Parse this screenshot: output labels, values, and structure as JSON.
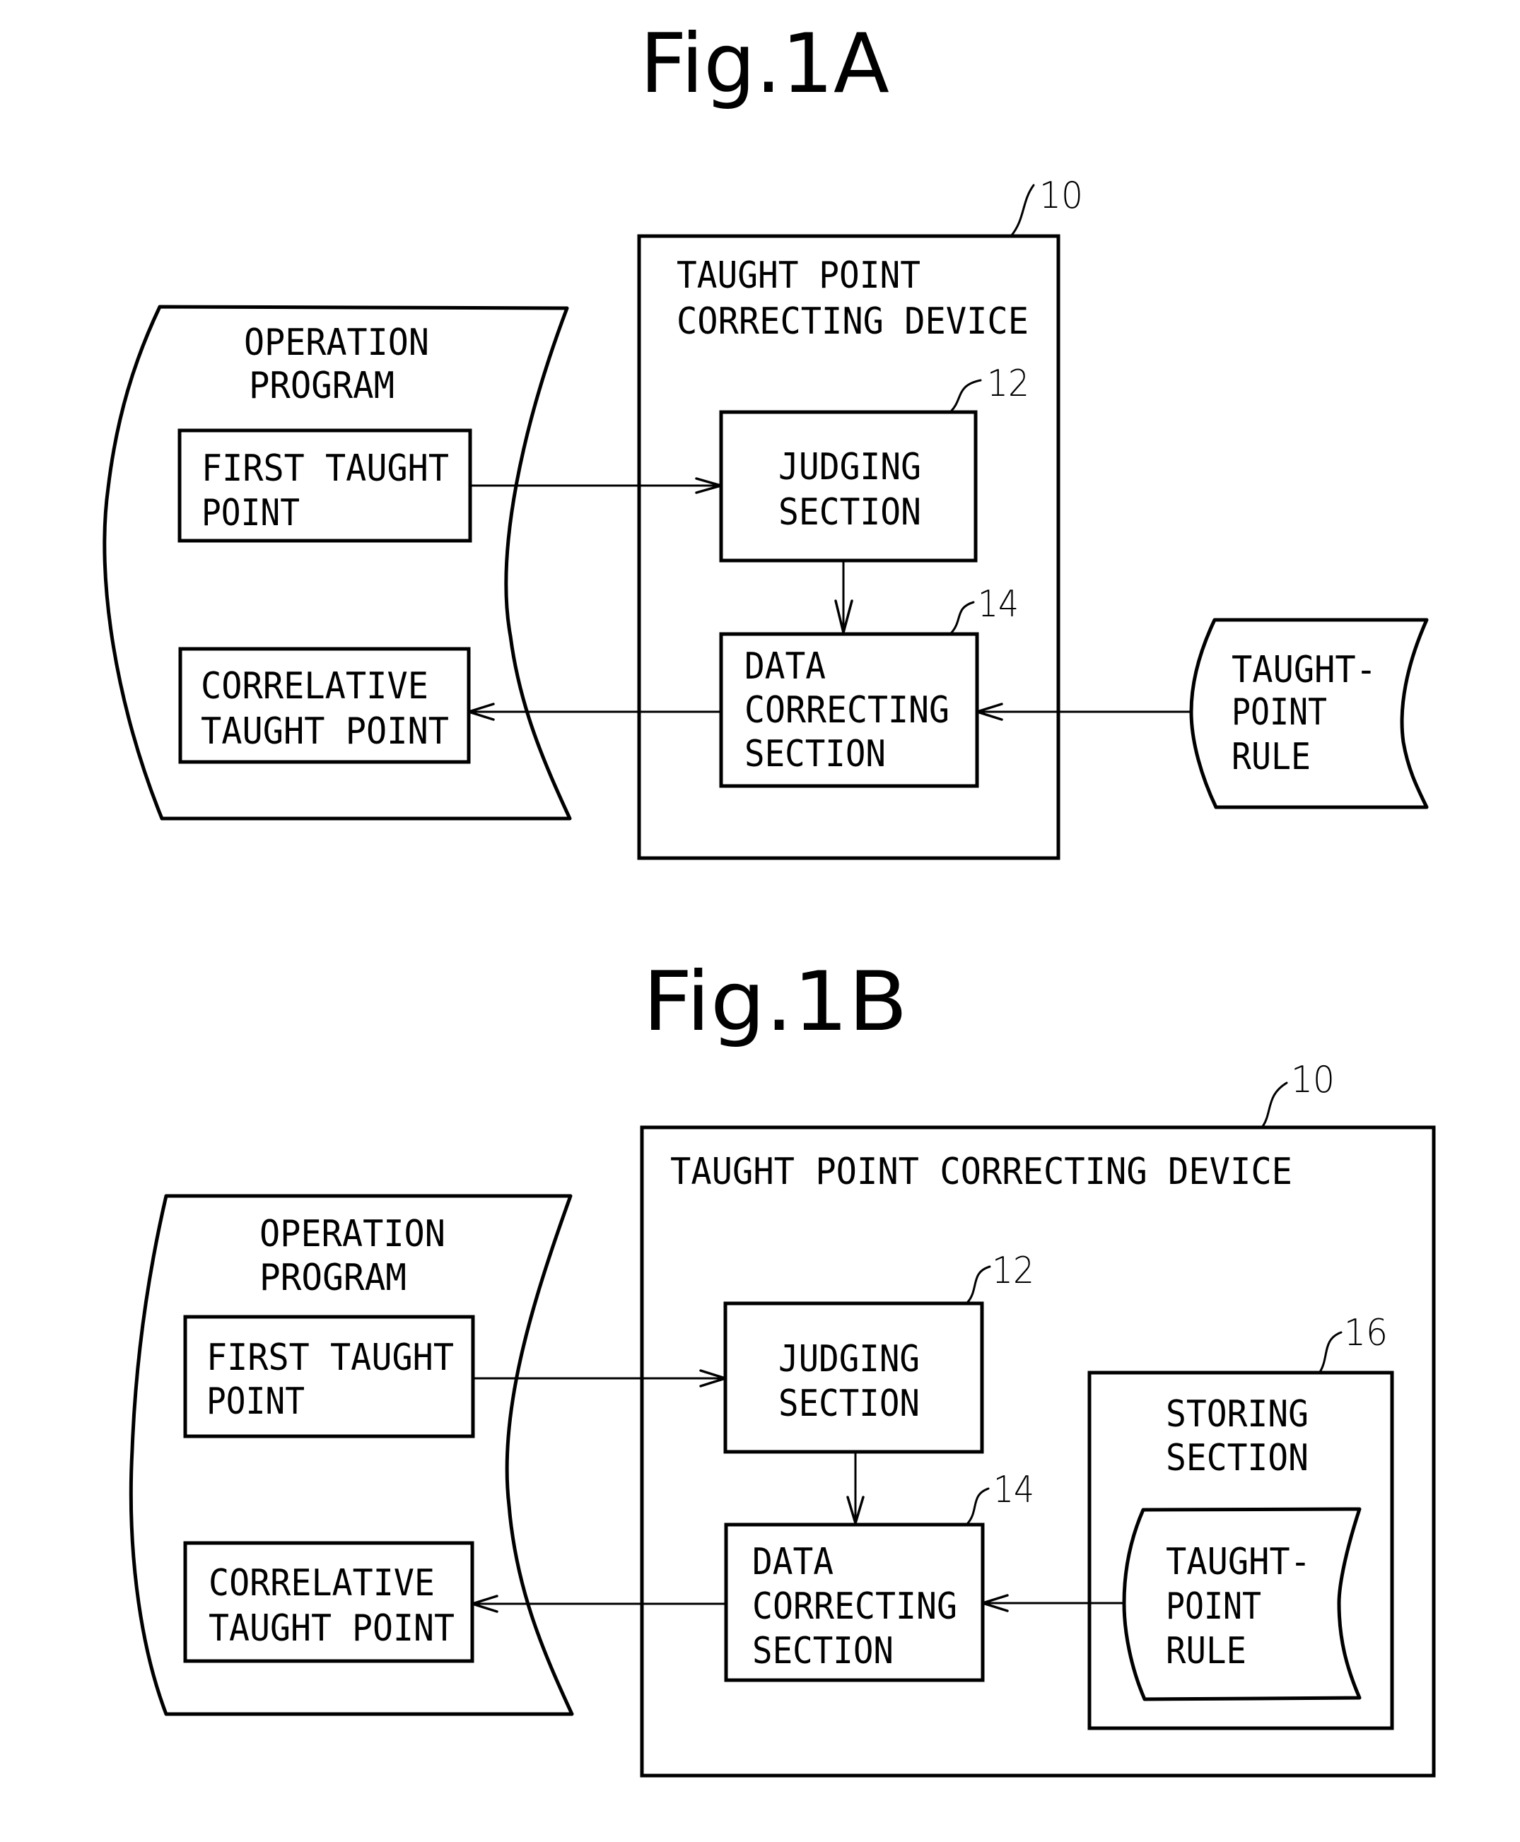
{
  "figures": [
    {
      "id": "fig1a",
      "title": "Fig.1A",
      "device": {
        "ref": "10",
        "lines": [
          "TAUGHT POINT",
          "CORRECTING DEVICE"
        ]
      },
      "operation_program": {
        "lines": [
          "OPERATION",
          "PROGRAM"
        ],
        "first_taught_point": [
          "FIRST TAUGHT",
          "POINT"
        ],
        "correlative_taught_point": [
          "CORRELATIVE",
          "TAUGHT POINT"
        ]
      },
      "judging_section": {
        "ref": "12",
        "lines": [
          "JUDGING",
          "SECTION"
        ]
      },
      "data_correcting_section": {
        "ref": "14",
        "lines": [
          "DATA",
          "CORRECTING",
          "SECTION"
        ]
      },
      "taught_point_rule": {
        "lines": [
          "TAUGHT-",
          "POINT",
          "RULE"
        ]
      }
    },
    {
      "id": "fig1b",
      "title": "Fig.1B",
      "device": {
        "ref": "10",
        "lines": [
          "TAUGHT POINT CORRECTING DEVICE"
        ]
      },
      "operation_program": {
        "lines": [
          "OPERATION",
          "PROGRAM"
        ],
        "first_taught_point": [
          "FIRST TAUGHT",
          "POINT"
        ],
        "correlative_taught_point": [
          "CORRELATIVE",
          "TAUGHT POINT"
        ]
      },
      "judging_section": {
        "ref": "12",
        "lines": [
          "JUDGING",
          "SECTION"
        ]
      },
      "data_correcting_section": {
        "ref": "14",
        "lines": [
          "DATA",
          "CORRECTING",
          "SECTION"
        ]
      },
      "storing_section": {
        "ref": "16",
        "lines": [
          "STORING",
          "SECTION"
        ]
      },
      "taught_point_rule": {
        "lines": [
          "TAUGHT-",
          "POINT",
          "RULE"
        ]
      }
    }
  ]
}
